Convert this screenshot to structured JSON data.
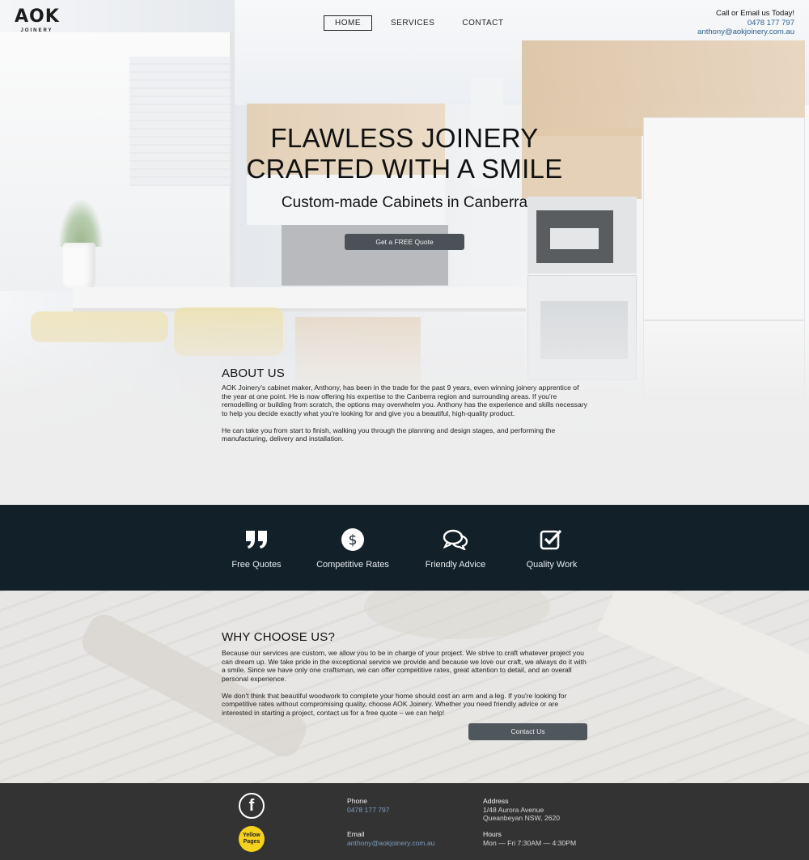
{
  "logo": {
    "mark": "AOK",
    "sub": "JOINERY"
  },
  "nav": {
    "items": [
      "HOME",
      "SERVICES",
      "CONTACT"
    ],
    "active": "HOME"
  },
  "header_contact": {
    "label": "Call or Email us Today!",
    "phone": "0478 177 797",
    "email": "anthony@aokjoinery.com.au"
  },
  "hero": {
    "title_line1": "FLAWLESS JOINERY",
    "title_line2": "CRAFTED WITH A SMILE",
    "subtitle": "Custom-made Cabinets in Canberra",
    "cta": "Get a FREE Quote"
  },
  "about": {
    "heading": "ABOUT US",
    "p1": "AOK Joinery's cabinet maker, Anthony, has been in the trade for the past 9 years, even winning joinery apprentice of the year at one point. He is now offering his expertise to the Canberra region and surrounding areas. If you're remodelling or building from scratch, the options may overwhelm you. Anthony has the experience and skills necessary to help you decide exactly what you're looking for and give you a beautiful, high-quality product.",
    "p2": "He can take you from start to finish, walking you through the planning and design stages, and performing the manufacturing, delivery and installation."
  },
  "features": [
    {
      "icon": "quote-icon",
      "label": "Free Quotes"
    },
    {
      "icon": "dollar-icon",
      "label": "Competitive Rates"
    },
    {
      "icon": "chat-icon",
      "label": "Friendly Advice"
    },
    {
      "icon": "checkbox-icon",
      "label": "Quality Work"
    }
  ],
  "why": {
    "heading": "WHY CHOOSE US?",
    "p1": "Because our services are custom, we allow you to be in charge of your project. We strive to craft whatever project you can dream up. We take pride in the exceptional service we provide and because we love our craft, we always do it with a smile. Since we have only one craftsman, we can offer competitive rates, great attention to detail, and an overall personal experience.",
    "p2": "We don't think that beautiful woodwork to complete your home should cost an arm and a leg. If you're looking for competitive rates without compromising quality, choose AOK Joinery. Whether you need friendly advice or are interested in starting a project, contact us for a free quote – we can help!",
    "cta": "Contact Us"
  },
  "footer": {
    "facebook": "f",
    "yellow_pages": "Yellow Pages",
    "phone_label": "Phone",
    "phone": "0478 177 797",
    "email_label": "Email",
    "email": "anthony@aokjoinery.com.au",
    "address_label": "Address",
    "address_line1": "1/48 Aurora Avenue",
    "address_line2": "Queanbeyan NSW, 2620",
    "hours_label": "Hours",
    "hours": "Mon — Fri 7:30AM — 4:30PM"
  },
  "colors": {
    "dark_band": "#112029",
    "footer": "#333333",
    "button": "#4b5157",
    "link": "#2f5e92"
  }
}
